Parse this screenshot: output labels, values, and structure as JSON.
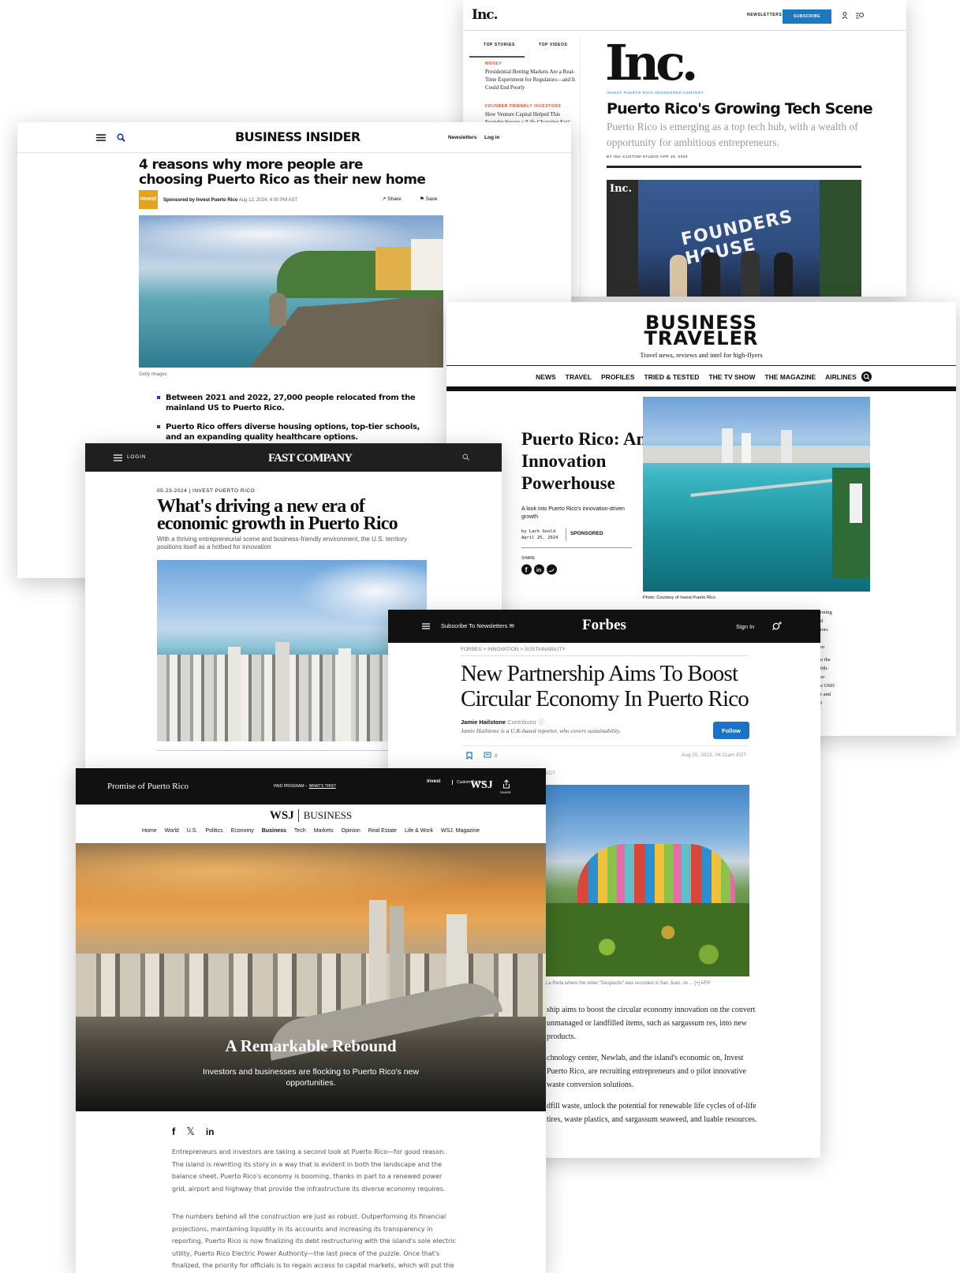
{
  "inc": {
    "logo": "Inc.",
    "newsletters": "NEWSLETTERS",
    "subscribe": "SUBSCRIBE",
    "tabs": [
      "TOP STORIES",
      "TOP VIDEOS"
    ],
    "stories": [
      {
        "category": "MONEY",
        "title": "Presidential Betting Markets Are a Real-Time Experiment for Regulators—and It Could End Poorly"
      },
      {
        "category": "FOUNDER FRIENDLY INVESTORS",
        "title": "How Venture Capital Helped This Founder Secure a 'Life-Changing Exit'"
      }
    ],
    "tag": "INVEST PUERTO RICO  SPONSORED CONTENT",
    "title": "Puerto Rico's Growing Tech Scene",
    "dek": "Puerto Rico is emerging as a top tech hub, with a wealth of opportunity for ambitious entrepreneurs.",
    "byline": "BY INC-CUSTOM-STUDIO   APR 19, 2024",
    "photo_logo": "Inc.",
    "photo_text": "FOUNDERS HOUSE"
  },
  "bi": {
    "logo": "BUSINESS INSIDER",
    "newsletters": "Newsletters",
    "login": "Log in",
    "headline": "4 reasons why more people are choosing Puerto Rico as their new home",
    "avatar": "invest",
    "sponsor": "Sponsored by Invest Puerto Rico",
    "date": "Aug 12, 2024, 4:00 PM AST",
    "share": "Share",
    "save": "Save",
    "caption": "Getty Images",
    "bullets": [
      "Between 2021 and 2022, 27,000 people relocated from the mainland US to Puerto Rico.",
      "Puerto Rico offers diverse housing options, top-tier schools, and an expanding quality healthcare options."
    ]
  },
  "bt": {
    "logo1": "BUSINESS",
    "logo2": "TRAVELER",
    "tagline": "Travel news, reviews and intel for high-flyers",
    "nav": [
      "NEWS",
      "TRAVEL",
      "PROFILES",
      "TRIED & TESTED",
      "THE TV SHOW",
      "THE MAGAZINE",
      "AIRLINES"
    ],
    "headline": "Puerto Rico: An Innovation Powerhouse",
    "dek": "A look into Puerto Rico's innovation-driven growth",
    "byline": "by Lark Gould",
    "date": "April 25, 2024",
    "sponsored": "SPONSORED",
    "share": "SHARE",
    "caption": "Photo: Courtesy of Invest Puerto Rico",
    "peek": [
      "oning",
      "d",
      "tors",
      "",
      "or",
      "",
      "o the",
      "6th-",
      "or",
      "o OSD",
      "r and",
      "I"
    ]
  },
  "fc": {
    "login": "LOGIN",
    "logo": "FAST COMPANY",
    "kicker": "05-23-2024 | INVEST PUERTO RICO",
    "headline": "What's driving a new era of economic growth in Puerto Rico",
    "dek": "With a thriving entrepreneurial scene and business-friendly environment, the U.S. territory positions itself as a hotbed for innovation"
  },
  "forbes": {
    "subscribe": "Subscribe To Newsletters",
    "logo": "Forbes",
    "signin": "Sign In",
    "breadcrumb": "FORBES  >  INNOVATION  >  SUSTAINABILITY",
    "headline": "New Partnership Aims To Boost Circular Economy In Puerto Rico",
    "author": "Jamie Hailstone",
    "author_role": "Contributor",
    "bio": "Jamie Hailstone is a U.K-based reporter, who covers sustainability.",
    "follow": "Follow",
    "comments": "0",
    "date": "Aug 25, 2023, 04:31am EDT",
    "edt": "EDT",
    "caption": "La Perla where the video \"Despacito\" was recorded in San Juan, on ... [+]  AFP",
    "paragraphs": [
      "ship aims to boost the circular economy innovation on the convert unmanaged or landfilled items, such as sargassum res, into new products.",
      "chnology center, Newlab, and the island's economic on, Invest Puerto Rico, are recruiting entrepreneurs and o pilot innovative waste conversion solutions.",
      "dfill waste, unlock the potential for renewable life cycles of of-life tires, waste plastics, and sargassum seaweed, and luable resources."
    ]
  },
  "wsj": {
    "brand": "Promise of Puerto Rico",
    "paid": "PAID PROGRAM –",
    "whats": "WHAT'S THIS?",
    "invest": "invest",
    "custom": "Custom Content",
    "logo": "WSJ",
    "share": "SHARE",
    "mast_left": "WSJ",
    "mast_right": "BUSINESS",
    "nav": [
      "Home",
      "World",
      "U.S.",
      "Politics",
      "Economy",
      "Business",
      "Tech",
      "Markets",
      "Opinion",
      "Real Estate",
      "Life & Work",
      "WSJ. Magazine"
    ],
    "hero_title": "A Remarkable Rebound",
    "hero_dek": "Investors and businesses are flocking to Puerto Rico's new opportunities.",
    "p1": "Entrepreneurs and investors are taking a second look at Puerto Rico—for good reason. The island is rewriting its story in a way that is evident in both the landscape and the balance sheet. Puerto Rico's economy is booming, thanks in part to a renewed power grid, airport and highway that provide the infrastructure its diverse economy requires.",
    "p2": "The numbers behind all the construction are just as robust. Outperforming its financial projections, maintaining liquidity in its accounts and increasing its transparency in reporting, Puerto Rico is now finalizing its debt restructuring with the island's sole electric utility, Puerto Rico Electric Power Authority—the last piece of the puzzle. Once that's finalized, the priority for officials is to regain access to capital markets, which will put the island in an even"
  },
  "colors": {
    "inc_blue": "#1b79bf",
    "inc_orange": "#e2512b",
    "bi_blue": "#1a3ac7",
    "forbes_blue": "#1a73c7"
  }
}
